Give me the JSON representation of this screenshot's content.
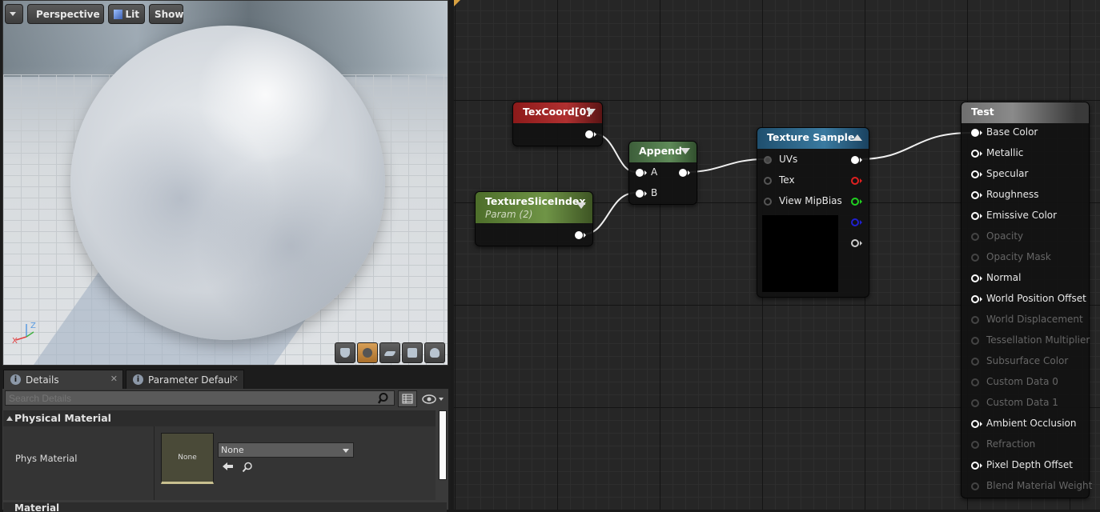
{
  "viewport": {
    "buttons": {
      "menu": "",
      "perspective": "Perspective",
      "lit": "Lit",
      "show": "Show"
    },
    "tools": [
      "cylinder-icon",
      "sphere-icon",
      "plane-icon",
      "cube-icon",
      "teapot-icon"
    ]
  },
  "tabs": [
    {
      "label": "Details"
    },
    {
      "label": "Parameter Defaults"
    }
  ],
  "details": {
    "search_placeholder": "Search Details",
    "section": "Physical Material",
    "phys_label": "Phys Material",
    "thumb_text": "None",
    "combo_value": "None",
    "section2": "Material"
  },
  "graph": {
    "nodes": {
      "texcoord": {
        "title": "TexCoord[0]"
      },
      "slice": {
        "title": "TextureSliceIndex",
        "subtitle": "Param (2)"
      },
      "append": {
        "title": "Append",
        "inputs": [
          "A",
          "B"
        ]
      },
      "texture": {
        "title": "Texture Sample",
        "inputs": [
          "UVs",
          "Tex",
          "View MipBias"
        ]
      },
      "result": {
        "title": "Test",
        "pins": [
          {
            "label": "Base Color",
            "enabled": true,
            "connected": true
          },
          {
            "label": "Metallic",
            "enabled": true
          },
          {
            "label": "Specular",
            "enabled": true
          },
          {
            "label": "Roughness",
            "enabled": true
          },
          {
            "label": "Emissive Color",
            "enabled": true
          },
          {
            "label": "Opacity",
            "enabled": false
          },
          {
            "label": "Opacity Mask",
            "enabled": false
          },
          {
            "label": "Normal",
            "enabled": true
          },
          {
            "label": "World Position Offset",
            "enabled": true
          },
          {
            "label": "World Displacement",
            "enabled": false
          },
          {
            "label": "Tessellation Multiplier",
            "enabled": false
          },
          {
            "label": "Subsurface Color",
            "enabled": false
          },
          {
            "label": "Custom Data 0",
            "enabled": false
          },
          {
            "label": "Custom Data 1",
            "enabled": false
          },
          {
            "label": "Ambient Occlusion",
            "enabled": true
          },
          {
            "label": "Refraction",
            "enabled": false
          },
          {
            "label": "Pixel Depth Offset",
            "enabled": true
          },
          {
            "label": "Blend Material Weight",
            "enabled": false
          }
        ]
      }
    },
    "pin_colors": {
      "red": "#e02020",
      "green": "#20d020",
      "blue": "#2020d0",
      "white": "#ffffff"
    }
  }
}
